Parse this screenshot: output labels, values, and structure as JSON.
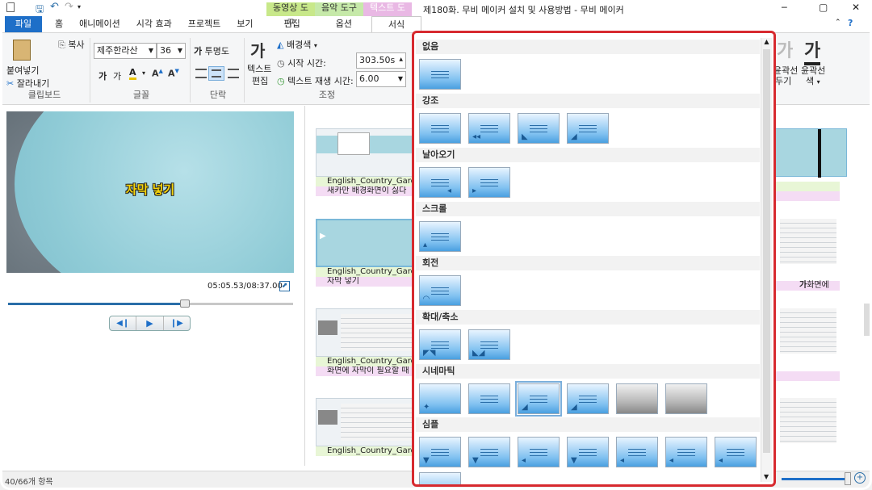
{
  "window": {
    "title": "제180화. 무비 메이커 설치 및 사용방법 - 무비 메이커",
    "minimize": "─",
    "maximize": "▢",
    "close": "✕"
  },
  "context_tabs": [
    "동영상 도구",
    "음악 도구",
    "텍스트 도구"
  ],
  "tabs": [
    "파일",
    "홈",
    "애니메이션",
    "시각 효과",
    "프로젝트",
    "보기",
    "편집",
    "옵션",
    "서식"
  ],
  "ribbon": {
    "clipboard": {
      "paste": "붙여넣기",
      "copy": "복사",
      "cut": "잘라내기",
      "group": "클립보드"
    },
    "font": {
      "family": "제주한라산",
      "size": "36",
      "bold": "가",
      "normal": "가",
      "group": "글꼴"
    },
    "paragraph": {
      "transparency": "투명도",
      "group": "단락"
    },
    "adjust": {
      "bg_color": "배경색",
      "start_time_label": "시작 시간:",
      "start_time": "303.50s",
      "duration_label": "텍스트 재생 시간:",
      "duration": "6.00",
      "edit_text": "텍스트",
      "edit_text2": "편집",
      "group": "조정"
    },
    "outline": {
      "btn1_glyph": "가",
      "btn1_label_a": "윤곽선",
      "btn1_label_b": "두기",
      "btn2_glyph": "가",
      "btn2_label_a": "윤곽선",
      "btn2_label_b": "색"
    }
  },
  "preview": {
    "caption": "자막 넣기",
    "time": "05:05.53/08:37.00",
    "progress": 0.62
  },
  "storyboard": {
    "clips": [
      {
        "caption": "English_Country_Garde",
        "subtitle": "새카만 배경화면이 싫다"
      },
      {
        "caption": "English_Country_Garde",
        "subtitle": "자막 넣기"
      },
      {
        "caption": "English_Country_Garde",
        "subtitle": "화면에 자막이 필요할 때"
      },
      {
        "caption": "English_Country_Garde",
        "subtitle": ""
      }
    ],
    "right_subtitle": "화면에"
  },
  "gallery": {
    "sections": [
      {
        "title": "없음",
        "count": 1
      },
      {
        "title": "강조",
        "count": 4
      },
      {
        "title": "날아오기",
        "count": 2
      },
      {
        "title": "스크롤",
        "count": 1
      },
      {
        "title": "회전",
        "count": 1
      },
      {
        "title": "확대/축소",
        "count": 2
      },
      {
        "title": "시네마틱",
        "count": 6
      },
      {
        "title": "심플",
        "count": 7
      }
    ]
  },
  "status": {
    "items": "40/66개 항목"
  },
  "colors": {
    "file_tab": "#1e6fc8",
    "highlight": "#d72a2f",
    "caption_green": "#e8f6d6",
    "caption_pink": "#f4dcf4"
  }
}
